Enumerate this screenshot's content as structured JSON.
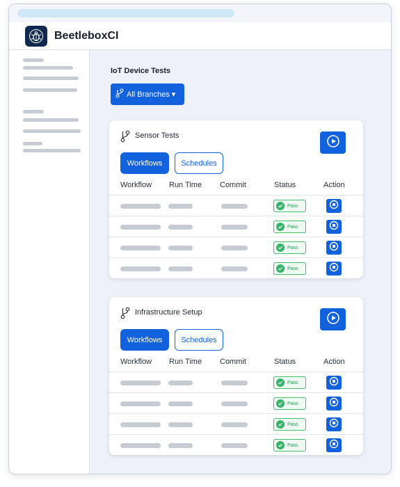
{
  "app": {
    "title": "BeetleboxCI",
    "logo_icon": "beetle-icon"
  },
  "page": {
    "title": "IoT Device Tests"
  },
  "branch_selector": {
    "label": "All Branches ▾",
    "icon": "git-branch-icon"
  },
  "tabs": {
    "workflows": "Workflows",
    "schedules": "Schedules"
  },
  "columns": [
    "Workflow",
    "Run Time",
    "Commit",
    "Status",
    "Action"
  ],
  "cards": [
    {
      "title": "Sensor Tests",
      "rows": [
        {
          "status": "Pass"
        },
        {
          "status": "Pass"
        },
        {
          "status": "Pass"
        },
        {
          "status": "Pass"
        }
      ]
    },
    {
      "title": "Infrastructure Setup",
      "rows": [
        {
          "status": "Pass"
        },
        {
          "status": "Pass"
        },
        {
          "status": "Pass"
        },
        {
          "status": "Pass"
        }
      ]
    }
  ],
  "colors": {
    "accent": "#1261dd",
    "pass": "#34b56a",
    "placeholder": "#c7cbd3"
  }
}
